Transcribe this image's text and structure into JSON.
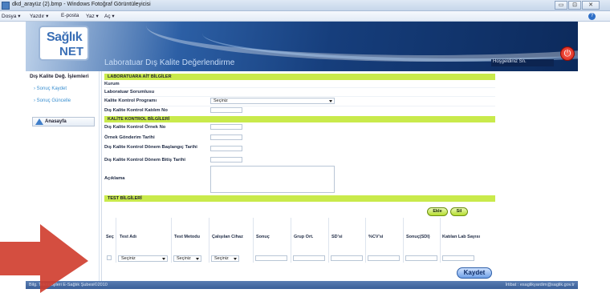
{
  "window": {
    "title": "dkd_arayüz (2).bmp - Windows Fotoğraf Görüntüleyicisi",
    "min_label": "▭",
    "max_label": "⊡",
    "close_label": "✕"
  },
  "menu": {
    "items": [
      "Dosya ▾",
      "Yazdır ▾",
      "E-posta",
      "Yaz ▾",
      "Aç ▾"
    ],
    "help_label": "?"
  },
  "banner": {
    "logo_line1": "Sağlık",
    "logo_line2": "NET",
    "title": "Laboratuar Dış Kalite Değerlendirme",
    "welcome": "Hoşgeldiniz Sn.",
    "power_label": "⏻"
  },
  "sidebar": {
    "header": "Dış Kalite Değ. İşlemleri",
    "items": [
      "› Sonuç Kaydet",
      "› Sonuç Güncelle"
    ],
    "home": "Anasayfa"
  },
  "lab_section": {
    "title": "LABORATUARA AİT BİLGİLER",
    "kurum": "Kurum",
    "sorumlu": "Laboratuar Sorumlusu",
    "program": "Kalite Kontrol Programı",
    "program_value": "Seçiniz",
    "katilim": "Dış Kalite Kontrol Katılım No"
  },
  "kk_section": {
    "title": "KALİTE KONTROL BİLGİLERİ",
    "ornek_no": "Dış Kalite Kontrol Örnek No",
    "gonderim": "Örnek Gönderim Tarihi",
    "baslangic": "Dış Kalite Kontrol Dönem Başlangıç Tarihi",
    "bitis": "Dış Kalite Kontrol Dönem Bitiş Tarihi",
    "aciklama": "Açıklama"
  },
  "test_section": {
    "title": "TEST BİLGİLERİ",
    "ekle": "Ekle",
    "sil": "Sil",
    "columns": [
      "Seç",
      "Test Adı",
      "Test Metodu",
      "Çalışılan Cihaz",
      "Sonuç",
      "Grup Ort.",
      "SD'si",
      "%CV'si",
      "Sonuç(SDI)",
      "Katılan Lab Sayısı"
    ],
    "row": {
      "test_adi": "Seçiniz",
      "test_metodu": "Seçiniz",
      "cihaz": "Seçiniz"
    },
    "kaydet": "Kaydet"
  },
  "status": {
    "left": "Bilg. Teknolojileri E-Sağlık Şubesi©2010",
    "right": "İrtibat : esaglikyardim@saglik.gov.tr"
  },
  "colors": {
    "accent": "#c9ea4b",
    "banner_dark": "#0c2a5c",
    "arrow": "#cf3b2b"
  }
}
